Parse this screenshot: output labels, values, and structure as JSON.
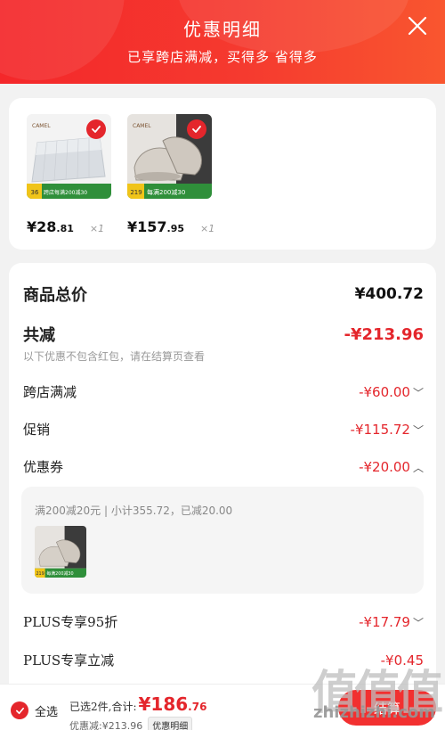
{
  "header": {
    "title": "优惠明细",
    "subtitle": "已享跨店满减，买得多 省得多"
  },
  "goods": [
    {
      "brand": "CAMEL",
      "price_main": "¥28",
      "price_decimal": ".81",
      "qty": "×1",
      "tag_price": "36",
      "tag_text": "跨店每满200减30"
    },
    {
      "brand": "CAMEL",
      "price_main": "¥157",
      "price_decimal": ".95",
      "qty": "×1",
      "tag_price": "219",
      "tag_text": "每满200减30"
    }
  ],
  "detail": {
    "total_label": "商品总价",
    "total_value": "¥400.72",
    "reduce_label": "共减",
    "reduce_value": "-¥213.96",
    "note": "以下优惠不包含红包，请在结算页查看",
    "cross_store_label": "跨店满减",
    "cross_store_value": "-¥60.00",
    "promo_label": "促销",
    "promo_value": "-¥115.72",
    "coupon_label": "优惠券",
    "coupon_value": "-¥20.00",
    "coupon_desc": "满200减20元 | 小计355.72，已减20.00",
    "coupon_item_tag_price": "219",
    "coupon_item_tag_text": "每满200减30",
    "plus95_label": "PLUS专享95折",
    "plus95_value": "-¥17.79",
    "plusdir_label": "PLUS专享立减",
    "plusdir_value": "-¥0.45"
  },
  "bottom": {
    "select_all": "全选",
    "summary_text": "已选2件,合计:",
    "summary_amount_main": "¥186",
    "summary_amount_decimal": ".76",
    "reduced_text": "优惠减:¥213.96",
    "detail_tag": "优惠明细",
    "checkout": "结算"
  },
  "watermark": {
    "glyphs": "值值值",
    "url": "zhizhizhi.com"
  },
  "colors": {
    "accent_red": "#e4262c",
    "header_red": "#f4272a"
  },
  "icons": {
    "close": "close-icon",
    "check": "check-icon",
    "chevron_down": "chevron-down-icon",
    "chevron_up": "chevron-up-icon"
  }
}
